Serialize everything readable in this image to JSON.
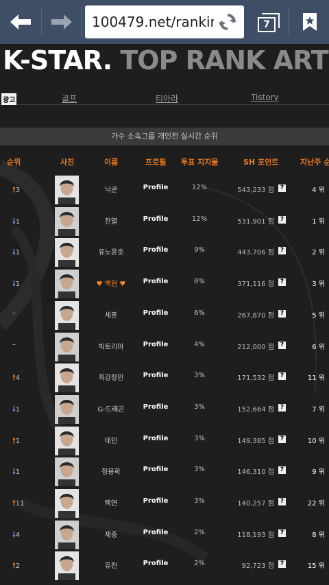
{
  "browser": {
    "url": "100479.net/rankin",
    "tab_count": "7"
  },
  "page": {
    "banner_brand": "K-STAR.",
    "banner_subtitle": "TOP RANK ARTISTS(KOREAN S",
    "nav": {
      "ad_label": "광고",
      "links": [
        "골프",
        "티아라",
        "Tistory"
      ]
    },
    "section_title": "가수 소속그룹 개인전 실시간 순위",
    "columns": [
      "순위",
      "사진",
      "이름",
      "프로필",
      "투표 지지율",
      "SH 포인트",
      "지난주 순"
    ],
    "rows": [
      {
        "dir": "up",
        "change": "3",
        "name": "닉쿤",
        "profile": "Profile",
        "pct": "12%",
        "points": "543,233 점",
        "last": "4 위"
      },
      {
        "dir": "down",
        "change": "1",
        "name": "찬열",
        "profile": "Profile",
        "pct": "12%",
        "points": "531,901 점",
        "last": "1 위"
      },
      {
        "dir": "down",
        "change": "1",
        "name": "유노윤호",
        "profile": "Profile",
        "pct": "9%",
        "points": "443,706 점",
        "last": "2 위"
      },
      {
        "dir": "down",
        "change": "1",
        "name": "♥ 백현 ♥",
        "highlight": true,
        "profile": "Profile",
        "pct": "8%",
        "points": "371,116 점",
        "last": "3 위"
      },
      {
        "dir": "same",
        "change": "–",
        "name": "세훈",
        "profile": "Profile",
        "pct": "6%",
        "points": "267,870 점",
        "last": "5 위"
      },
      {
        "dir": "same",
        "change": "–",
        "name": "빅토리아",
        "profile": "Profile",
        "pct": "4%",
        "points": "212,000 점",
        "last": "6 위"
      },
      {
        "dir": "up",
        "change": "4",
        "name": "최강창민",
        "profile": "Profile",
        "pct": "3%",
        "points": "171,532 점",
        "last": "11 위"
      },
      {
        "dir": "down",
        "change": "1",
        "name": "G-드래곤",
        "profile": "Profile",
        "pct": "3%",
        "points": "152,664 점",
        "last": "7 위"
      },
      {
        "dir": "up",
        "change": "1",
        "name": "태민",
        "profile": "Profile",
        "pct": "3%",
        "points": "149,385 점",
        "last": "10 위"
      },
      {
        "dir": "down",
        "change": "1",
        "name": "정용화",
        "profile": "Profile",
        "pct": "3%",
        "points": "146,310 점",
        "last": "9 위"
      },
      {
        "dir": "up",
        "change": "11",
        "name": "택연",
        "profile": "Profile",
        "pct": "3%",
        "points": "140,257 점",
        "last": "22 위"
      },
      {
        "dir": "down",
        "change": "4",
        "name": "재중",
        "profile": "Profile",
        "pct": "2%",
        "points": "118,193 점",
        "last": "8 위"
      },
      {
        "dir": "up",
        "change": "2",
        "name": "유천",
        "profile": "Profile",
        "pct": "2%",
        "points": "92,723 점",
        "last": "15 위"
      }
    ],
    "info_icon_glyph": "?"
  }
}
